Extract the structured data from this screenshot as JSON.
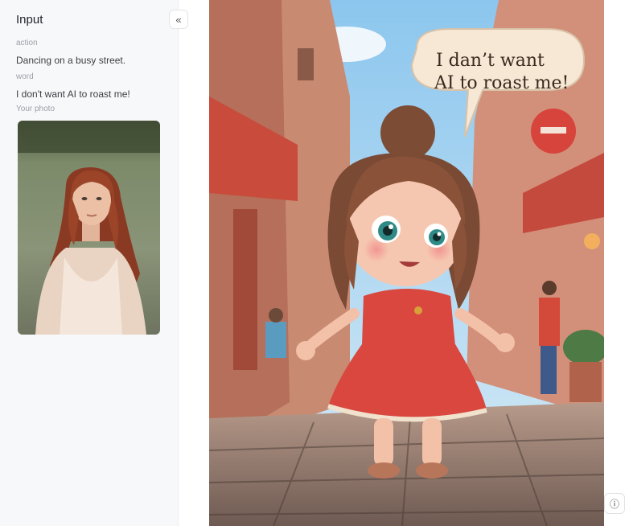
{
  "sidebar": {
    "title": "Input",
    "collapse_icon": "double-chevron-left-icon",
    "fields": [
      {
        "label": "action",
        "value": "Dancing on a busy street."
      },
      {
        "label": "word",
        "value": "I don't want AI to roast me!"
      }
    ],
    "photo_label": "Your photo"
  },
  "result": {
    "speech_line_1": "I dan’t want",
    "speech_line_2": "AI to roast me!"
  },
  "info_icon": "info-icon",
  "colors": {
    "sidebar_bg": "#f7f8fa",
    "dress": "#d9473f",
    "sky": "#a8d4f0"
  }
}
